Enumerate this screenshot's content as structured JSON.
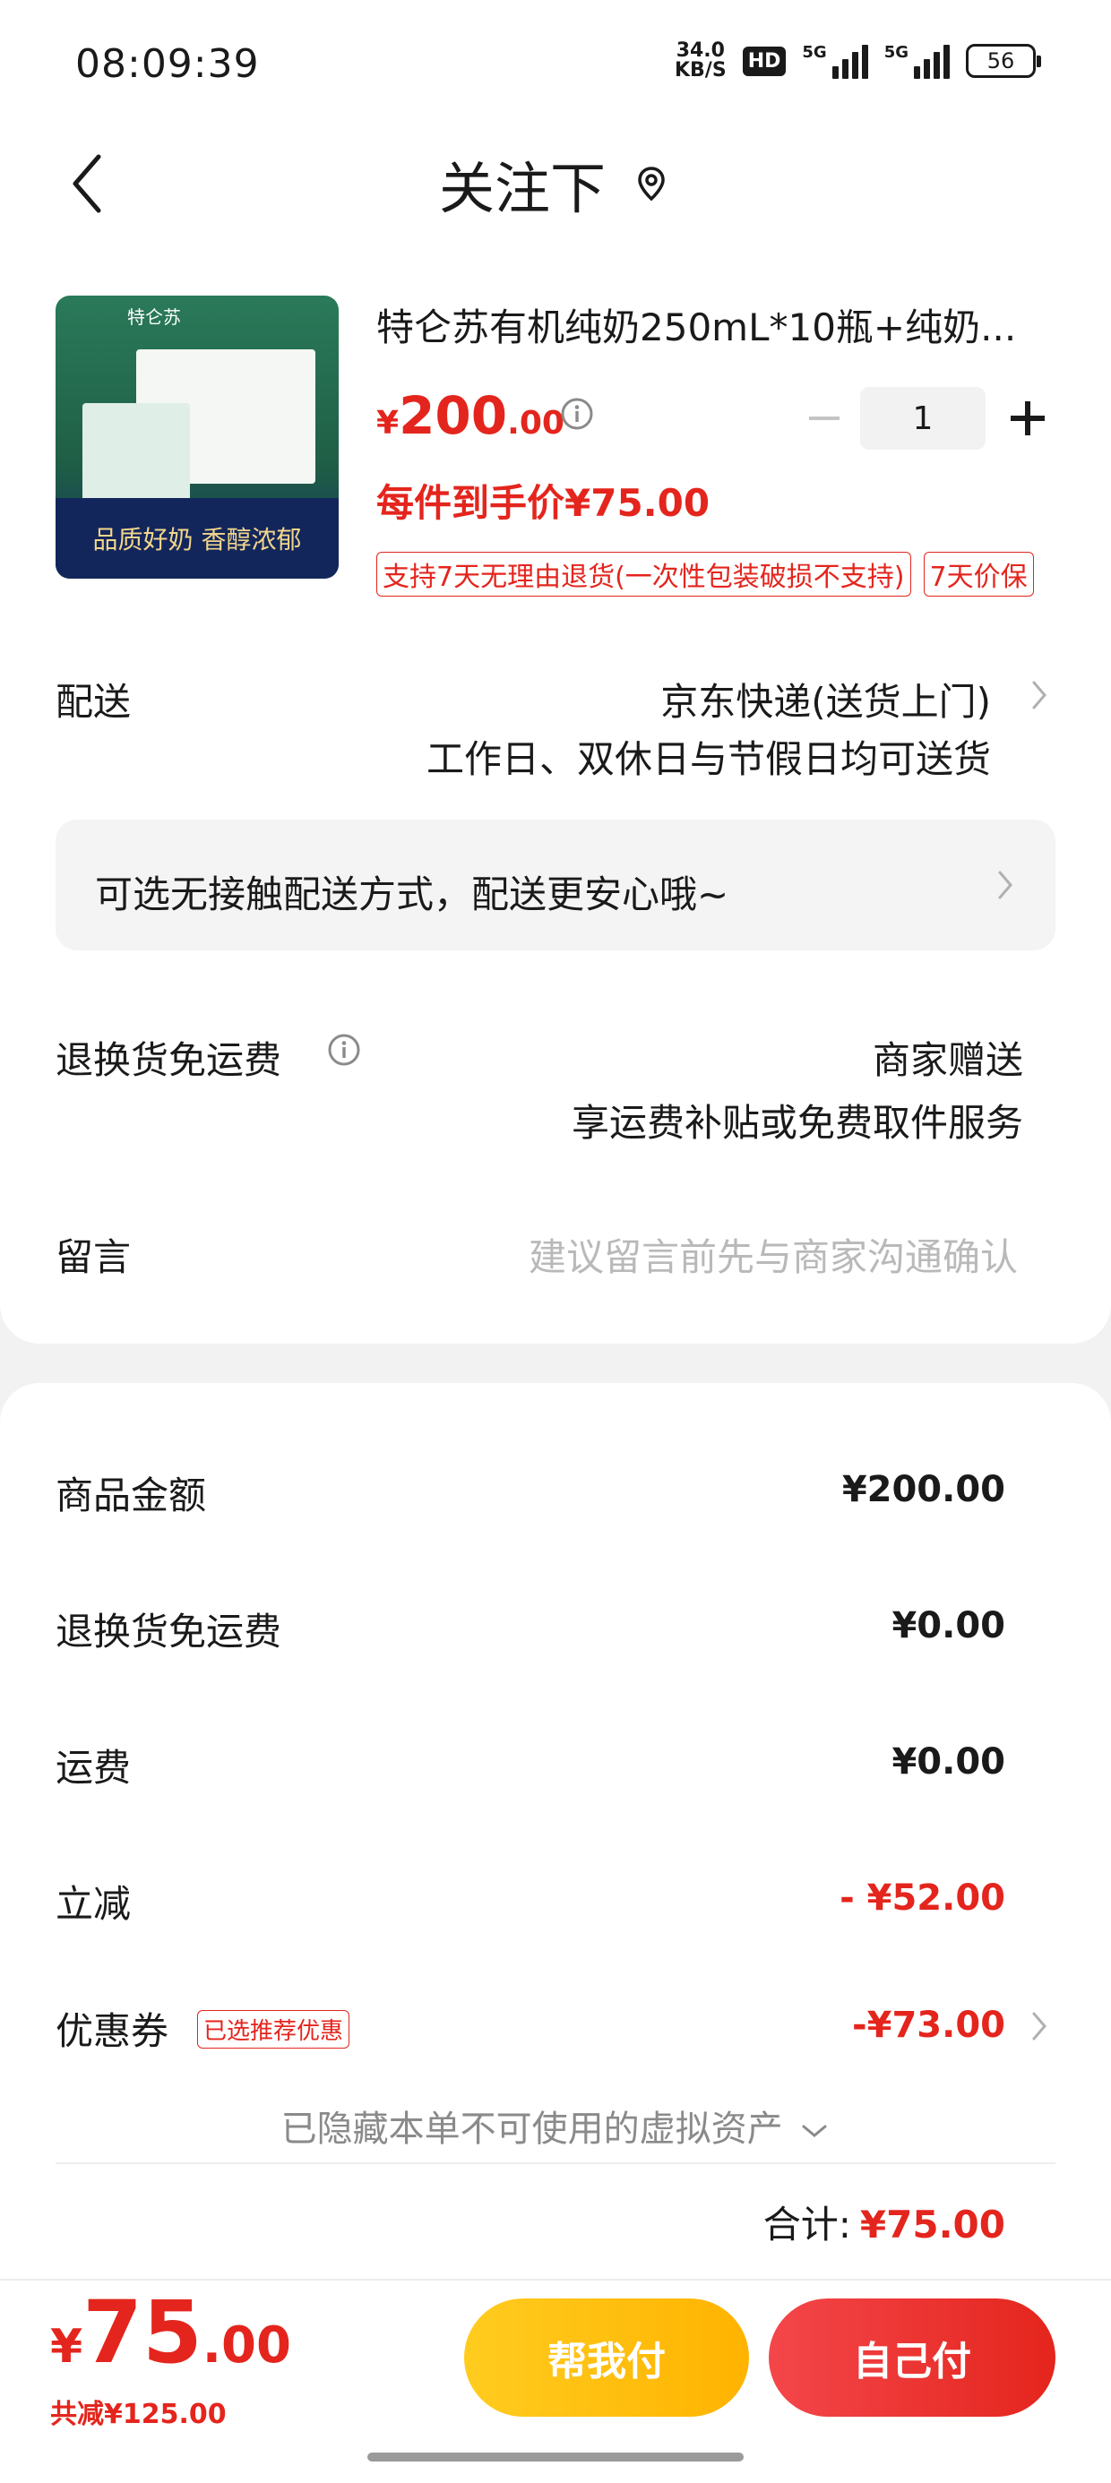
{
  "status_bar": {
    "time": "08:09:39",
    "net_speed_value": "34.0",
    "net_speed_unit": "KB/S",
    "hd_label": "HD",
    "signal1_label": "5G",
    "signal2_label": "5G",
    "battery": "56"
  },
  "header": {
    "title": "关注下"
  },
  "product": {
    "title": "特仑苏有机纯奶250mL*10瓶+纯奶...",
    "price_currency": "¥",
    "price_int": "200",
    "price_dec": ".00",
    "quantity": "1",
    "hand_price": "每件到手价¥75.00",
    "tags": [
      "支持7天无理由退货(一次性包装破损不支持)",
      "7天价保"
    ],
    "image_top_text": "特仑苏",
    "image_banner_text": "品质好奶 香醇浓郁"
  },
  "delivery": {
    "label": "配送",
    "method": "京东快递(送货上门)",
    "schedule": "工作日、双休日与节假日均可送货"
  },
  "contactless": {
    "text": "可选无接触配送方式，配送更安心哦~"
  },
  "return_shipping": {
    "label": "退换货免运费",
    "value": "商家赠送",
    "desc": "享运费补贴或免费取件服务"
  },
  "remark": {
    "label": "留言",
    "placeholder": "建议留言前先与商家沟通确认"
  },
  "summary": {
    "items": [
      {
        "label": "商品金额",
        "value": "¥200.00"
      },
      {
        "label": "退换货免运费",
        "value": "¥0.00"
      },
      {
        "label": "运费",
        "value": "¥0.00"
      },
      {
        "label": "立减",
        "value": "- ¥52.00"
      },
      {
        "label": "优惠券",
        "value": "-¥73.00"
      }
    ],
    "coupon_tag": "已选推荐优惠",
    "hidden_assets": "已隐藏本单不可使用的虚拟资产",
    "total_label": "合计:",
    "total_value": "¥75.00"
  },
  "bottom_bar": {
    "price_currency": "¥",
    "price_int": "75",
    "price_dec": ".00",
    "saved": "共减¥125.00",
    "help_pay_label": "帮我付",
    "self_pay_label": "自己付"
  },
  "colors": {
    "accent_red": "#e4251d",
    "help_pay_yellow": "#ffb300",
    "page_bg": "#f2f2f2"
  }
}
